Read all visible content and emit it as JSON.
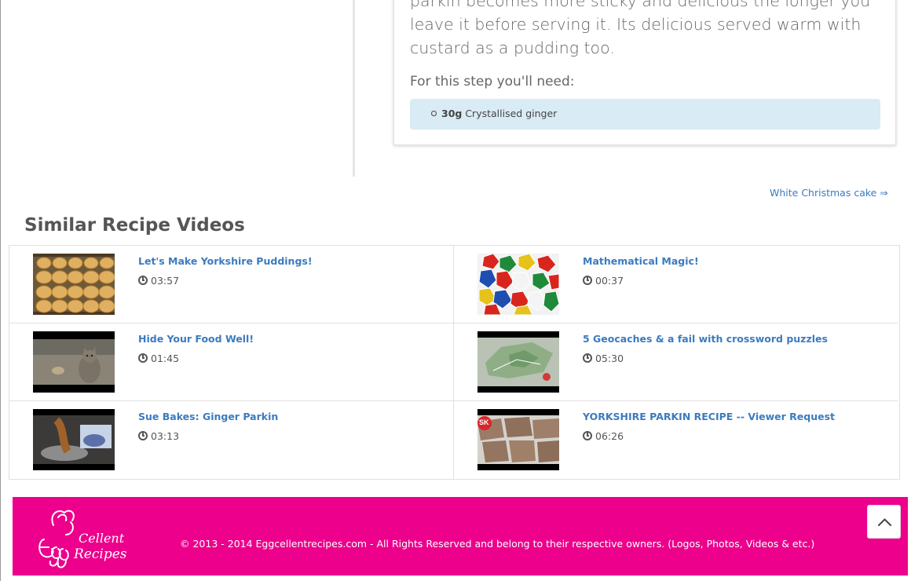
{
  "step": {
    "text": "parkin becomes more sticky and delicious the longer you leave it before serving it. Its delicious served warm with custard as a pudding too.",
    "need_label": "For this step you'll need:",
    "ingredients": [
      {
        "quantity": "30g",
        "name": "Crystallised ginger"
      }
    ]
  },
  "navigation": {
    "next_recipe": "White Christmas cake ⇒"
  },
  "similar_videos": {
    "title": "Similar Recipe Videos",
    "videos": [
      {
        "title": "Let's Make Yorkshire Puddings!",
        "duration": "03:57",
        "thumb": "yorkshire-puddings-thumbnail"
      },
      {
        "title": "Mathematical Magic!",
        "duration": "00:37",
        "thumb": "dice-thumbnail"
      },
      {
        "title": "Hide Your Food Well!",
        "duration": "01:45",
        "thumb": "cat-thumbnail"
      },
      {
        "title": "5 Geocaches & a fail with crossword puzzles",
        "duration": "05:30",
        "thumb": "map-thumbnail"
      },
      {
        "title": "Sue Bakes: Ginger Parkin",
        "duration": "03:13",
        "thumb": "baking-thumbnail"
      },
      {
        "title": "YORKSHIRE PARKIN RECIPE -- Viewer Request",
        "duration": "06:26",
        "thumb": "parkin-thumbnail"
      }
    ]
  },
  "footer": {
    "logo_text": "EggCellent Recipes",
    "copyright": "© 2013 - 2014 Eggcellentrecipes.com - All Rights Reserved and belong to their respective owners. (Logos, Photos, Videos & etc.)",
    "background_color": "#ec008c"
  },
  "colors": {
    "link": "#3b7bbf",
    "ingredient_box": "#d9ebf5"
  },
  "icons": {
    "duration": "clock-icon",
    "back_to_top": "chevron-up-icon"
  }
}
